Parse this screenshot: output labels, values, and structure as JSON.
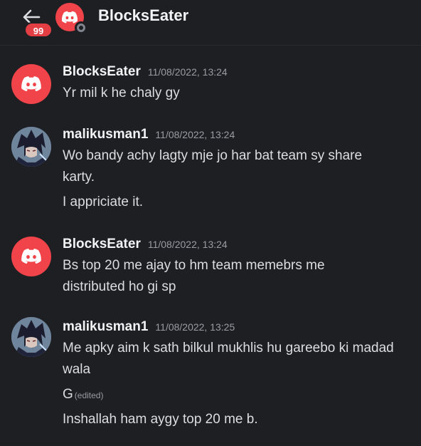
{
  "header": {
    "title": "BlocksEater",
    "badge_count": "99",
    "back_icon": "arrow-left-icon",
    "avatar_icon": "discord-logo-icon",
    "status": "offline"
  },
  "messages": [
    {
      "author": "BlocksEater",
      "timestamp": "11/08/2022, 13:24",
      "avatar": "discord-logo",
      "lines": [
        {
          "text": "Yr mil k he chaly gy"
        }
      ]
    },
    {
      "author": "malikusman1",
      "timestamp": "11/08/2022, 13:24",
      "avatar": "anime-character",
      "lines": [
        {
          "text": "Wo bandy achy lagty mje jo har bat team sy share karty."
        },
        {
          "text": "I appriciate it."
        }
      ]
    },
    {
      "author": "BlocksEater",
      "timestamp": "11/08/2022, 13:24",
      "avatar": "discord-logo",
      "lines": [
        {
          "text": "Bs top 20 me ajay to hm team memebrs me distributed ho gi sp"
        }
      ]
    },
    {
      "author": "malikusman1",
      "timestamp": "11/08/2022, 13:25",
      "avatar": "anime-character",
      "lines": [
        {
          "text": "Me apky aim k sath bilkul mukhlis hu gareebo ki madad wala"
        },
        {
          "text": "G",
          "edited": "(edited)"
        },
        {
          "text": "Inshallah ham aygy top 20 me b."
        }
      ]
    }
  ],
  "colors": {
    "background": "#1e1f23",
    "discord_red": "#f0444a",
    "badge_red": "#e23e44",
    "username": "#f2f3f5",
    "timestamp": "#9a9ca3",
    "message_text": "#dcdde1"
  }
}
